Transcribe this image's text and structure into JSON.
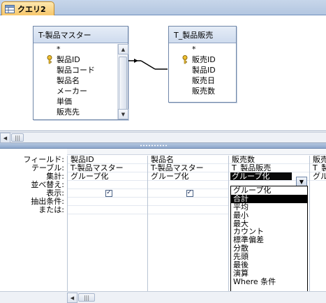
{
  "tab": {
    "icon": "query-icon",
    "label": "クエリ2"
  },
  "tables": [
    {
      "title": "T-製品マスター",
      "fields": [
        {
          "name": "*",
          "key": false
        },
        {
          "name": "製品ID",
          "key": true
        },
        {
          "name": "製品コード",
          "key": false
        },
        {
          "name": "製品名",
          "key": false
        },
        {
          "name": "メーカー",
          "key": false
        },
        {
          "name": "単価",
          "key": false
        },
        {
          "name": "販売先",
          "key": false
        }
      ]
    },
    {
      "title": "T_製品販売",
      "fields": [
        {
          "name": "*",
          "key": false
        },
        {
          "name": "販売ID",
          "key": true
        },
        {
          "name": "製品ID",
          "key": false
        },
        {
          "name": "販売日",
          "key": false
        },
        {
          "name": "販売数",
          "key": false
        }
      ]
    }
  ],
  "grid": {
    "row_labels": [
      "フィールド:",
      "テーブル:",
      "集計:",
      "並べ替え:",
      "表示:",
      "抽出条件:",
      "または:"
    ],
    "columns": [
      {
        "field": "製品ID",
        "table": "T-製品マスター",
        "total": "グループ化",
        "sort": "",
        "show": true
      },
      {
        "field": "製品名",
        "table": "T-製品マスター",
        "total": "グループ化",
        "sort": "",
        "show": true
      },
      {
        "field": "販売数",
        "table": "T_製品販売",
        "total": "グループ化",
        "sort": "",
        "show": null
      },
      {
        "field": "販売",
        "table": "T_製",
        "total": "グル",
        "sort": "",
        "show": null
      }
    ],
    "check_mark": "✓"
  },
  "dropdown": {
    "selected": "合計",
    "options": [
      "グループ化",
      "合計",
      "平均",
      "最小",
      "最大",
      "カウント",
      "標準偏差",
      "分散",
      "先頭",
      "最後",
      "演算",
      "Where 条件"
    ]
  },
  "colors": {
    "tab_bg": "#f7c76b",
    "splitter": "#8ea8cc",
    "selection": "#000000"
  }
}
